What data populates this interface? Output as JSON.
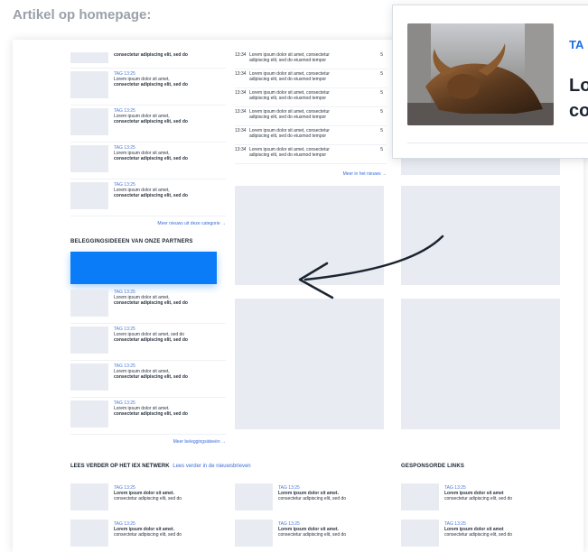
{
  "caption": "Artikel op homepage:",
  "left_first": {
    "meta": "",
    "line1": "consectetur adipiscing elit, sed do"
  },
  "left_items": [
    {
      "meta": "TAG 13:25",
      "line1": "Lorem ipsum dolor sit amet,",
      "line2": "consectetur adipiscing elit, sed do"
    },
    {
      "meta": "TAG 13:25",
      "line1": "Lorem ipsum dolor sit amet,",
      "line2": "consectetur adipiscing elit, sed do"
    },
    {
      "meta": "TAG 13:25",
      "line1": "Lorem ipsum dolor sit amet,",
      "line2": "consectetur adipiscing elit, sed do"
    },
    {
      "meta": "TAG 13:25",
      "line1": "Lorem ipsum dolor sit amet,",
      "line2": "consectetur adipiscing elit, sed do"
    }
  ],
  "left_more": "Meer nieuws uit deze categorie →",
  "partners_title": "BELEGGINGSIDEEEN VAN ONZE PARTNERS",
  "left_items2": [
    {
      "meta": "TAG 13:25",
      "line1": "Lorem ipsum dolor sit amet,",
      "line2": "consectetur adipiscing elit, sed do"
    },
    {
      "meta": "TAG 13:25",
      "line1": "Lorem ipsum dolor sit amet, sed do",
      "line2": "consectetur adipiscing elit, sed do"
    },
    {
      "meta": "TAG 13:25",
      "line1": "Lorem ipsum dolor sit amet,",
      "line2": "consectetur adipiscing elit, sed do"
    },
    {
      "meta": "TAG 13:25",
      "line1": "Lorem ipsum dolor sit amet.",
      "line2": "consectetur adipiscing elit, sed do"
    }
  ],
  "left_more2": "Meer beleggingsideeën →",
  "mid_rows": [
    {
      "time": "13:34",
      "line1": "Lorem ipsum dolor sit amet, consectetur",
      "line2": "adipiscing elit, sed do eiusmod tempor",
      "count": "5"
    },
    {
      "time": "13:34",
      "line1": "Lorem ipsum dolor sit amet, consectetur",
      "line2": "adipiscing elit, sed do eiusmod tempor",
      "count": "5"
    },
    {
      "time": "13:34",
      "line1": "Lorem ipsum dolor sit amet, consectetur",
      "line2": "adipiscing elit, sed do eiusmod tempor",
      "count": "5"
    },
    {
      "time": "13:34",
      "line1": "Lorem ipsum dolor sit amet, consectetur",
      "line2": "adipiscing elit, sed do eiusmod tempor",
      "count": "5"
    },
    {
      "time": "13:34",
      "line1": "Lorem ipsum dolor sit amet, consectetur",
      "line2": "adipiscing elit, sed do eiusmod tempor",
      "count": "5"
    },
    {
      "time": "13:34",
      "line1": "Lorem ipsum dolor sit amet, consectetur",
      "line2": "adipiscing elit, sed do eiusmod tempor",
      "count": "5"
    }
  ],
  "mid_more": "Meer in het nieuws →",
  "network_title": "LEES VERDER OP HET IEX NETWERK",
  "network_link": "Lees verder in de nieuwsbrieven",
  "sponsored_title": "GESPONSORDE LINKS",
  "network_items": [
    {
      "meta": "TAG 13:25",
      "line1": "Lorem ipsum dolor sit amet.",
      "line2": "consectetur adipiscing elit, sed do"
    },
    {
      "meta": "TAG 13:25",
      "line1": "Lorem ipsum dolor sit amet.",
      "line2": "consectetur adipiscing elit, sed do"
    },
    {
      "meta": "TAG 13:25",
      "line1": "Lorem ipsum dolor sit amet.",
      "line2": "consectetur adipiscing elit, sed do"
    },
    {
      "meta": "TAG 13:25",
      "line1": "Lorem ipsum dolor sit amet.",
      "line2": "consectetur adipiscing elit, sed do"
    },
    {
      "meta": "TAG 13:25",
      "line1": "Lorem ipsum dolor sit amet",
      "line2": "consectetur adipiscing elit, sed do"
    },
    {
      "meta": "TAG 13:25",
      "line1": "Lorem ipsum dolor sit amet",
      "line2": "consectetur adipiscing elit, sed do"
    }
  ],
  "card": {
    "tag": "TA",
    "title_line1": "Lo",
    "title_line2": "co"
  },
  "colors": {
    "accent": "#0a7cf7",
    "link": "#3b6cd8",
    "placeholder": "#e8ecf2"
  }
}
